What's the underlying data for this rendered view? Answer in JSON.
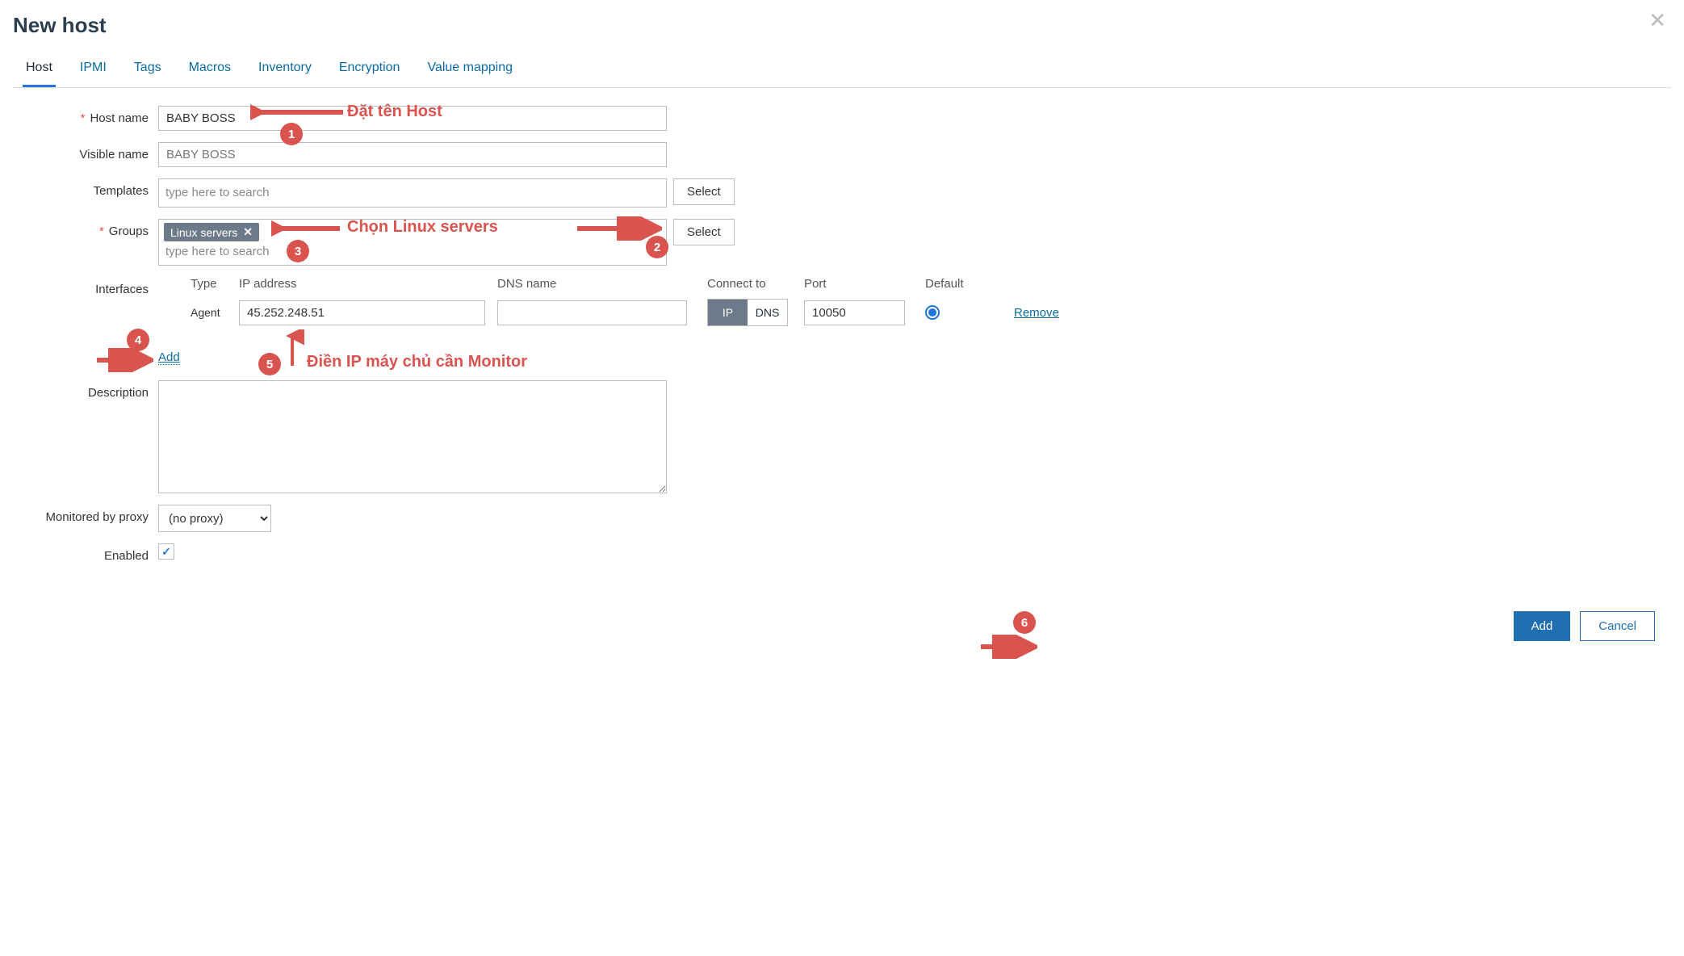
{
  "title": "New host",
  "tabs": [
    "Host",
    "IPMI",
    "Tags",
    "Macros",
    "Inventory",
    "Encryption",
    "Value mapping"
  ],
  "active_tab": 0,
  "labels": {
    "host_name": "Host name",
    "visible_name": "Visible name",
    "templates": "Templates",
    "groups": "Groups",
    "interfaces": "Interfaces",
    "description": "Description",
    "monitored_by_proxy": "Monitored by proxy",
    "enabled": "Enabled"
  },
  "fields": {
    "host_name": "BABY BOSS",
    "visible_name_placeholder": "BABY BOSS",
    "templates_placeholder": "type here to search",
    "groups_tag": "Linux servers",
    "groups_placeholder": "type here to search",
    "proxy": "(no proxy)",
    "enabled_checked": true
  },
  "select_label": "Select",
  "interfaces": {
    "headers": {
      "type": "Type",
      "ip": "IP address",
      "dns": "DNS name",
      "connect_to": "Connect to",
      "port": "Port",
      "default": "Default"
    },
    "row": {
      "type": "Agent",
      "ip": "45.252.248.51",
      "dns": "",
      "connect_ip": "IP",
      "connect_dns": "DNS",
      "port": "10050",
      "remove": "Remove"
    },
    "add": "Add"
  },
  "footer": {
    "add": "Add",
    "cancel": "Cancel"
  },
  "annotations": {
    "a1": "Đặt tên Host",
    "a2": "Chọn Linux servers",
    "a5": "Điền IP máy chủ cần Monitor",
    "badge1": "1",
    "badge2": "2",
    "badge3": "3",
    "badge4": "4",
    "badge5": "5",
    "badge6": "6"
  }
}
